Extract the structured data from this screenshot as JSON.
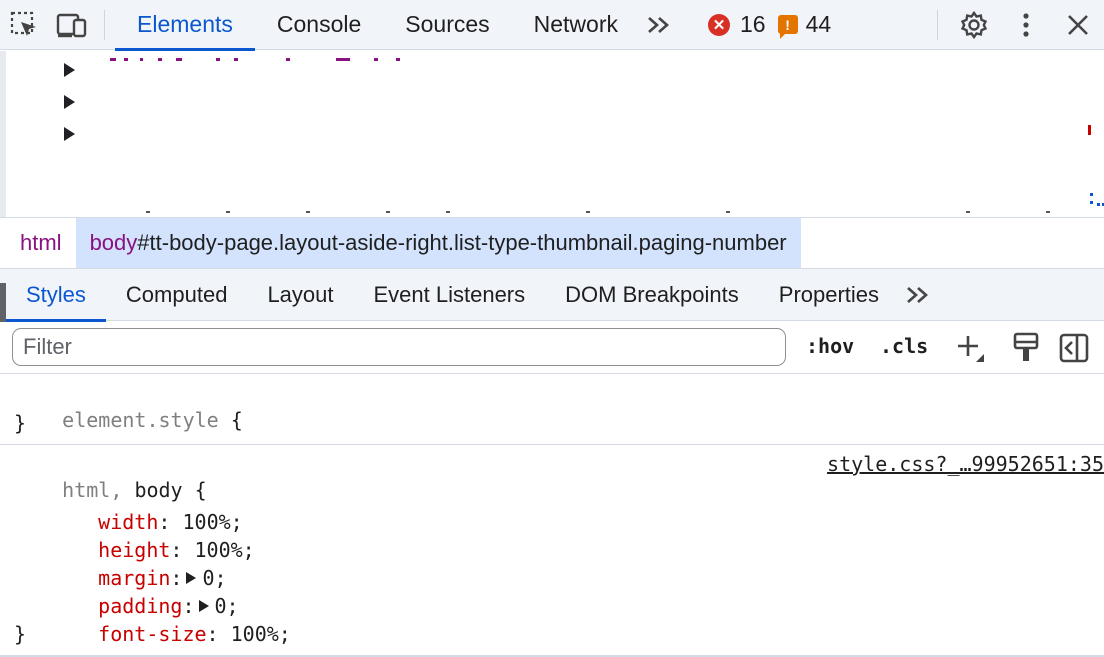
{
  "toolbar": {
    "tabs": [
      {
        "label": "Elements",
        "active": true
      },
      {
        "label": "Console",
        "active": false
      },
      {
        "label": "Sources",
        "active": false
      },
      {
        "label": "Network",
        "active": false
      }
    ],
    "more_tabs": ">>",
    "errors": {
      "count": "16",
      "glyph": "✕",
      "color": "#d93025"
    },
    "warnings": {
      "count": "44",
      "glyph": "!",
      "color": "#e37400"
    },
    "icons": [
      "inspect-element-icon",
      "device-toolbar-icon",
      "settings-icon",
      "more-vert-icon",
      "close-icon"
    ]
  },
  "breadcrumb": {
    "items": [
      {
        "tag": "html",
        "rest": ""
      },
      {
        "tag": "body",
        "rest": "#tt-body-page.layout-aside-right.list-type-thumbnail.paging-number"
      }
    ]
  },
  "subtabs": {
    "tabs": [
      {
        "label": "Styles",
        "active": true
      },
      {
        "label": "Computed",
        "active": false
      },
      {
        "label": "Layout",
        "active": false
      },
      {
        "label": "Event Listeners",
        "active": false
      },
      {
        "label": "DOM Breakpoints",
        "active": false
      },
      {
        "label": "Properties",
        "active": false
      }
    ],
    "more": ">>"
  },
  "filter": {
    "placeholder": "Filter",
    "value": "",
    "hov": ":hov",
    "cls": ".cls"
  },
  "rules": {
    "element_style": {
      "selector": "element.style",
      "open": "{",
      "close": "}"
    },
    "html_body": {
      "selector_grey": "html,",
      "selector_dark": "body",
      "open": "{",
      "close": "}",
      "source": "style.css?_…99952651:35",
      "props": [
        {
          "name": "width",
          "value": "100%;",
          "expandable": false
        },
        {
          "name": "height",
          "value": "100%;",
          "expandable": false
        },
        {
          "name": "margin",
          "value": "0;",
          "expandable": true
        },
        {
          "name": "padding",
          "value": "0;",
          "expandable": true
        },
        {
          "name": "font-size",
          "value": "100%;",
          "expandable": false
        }
      ]
    }
  }
}
